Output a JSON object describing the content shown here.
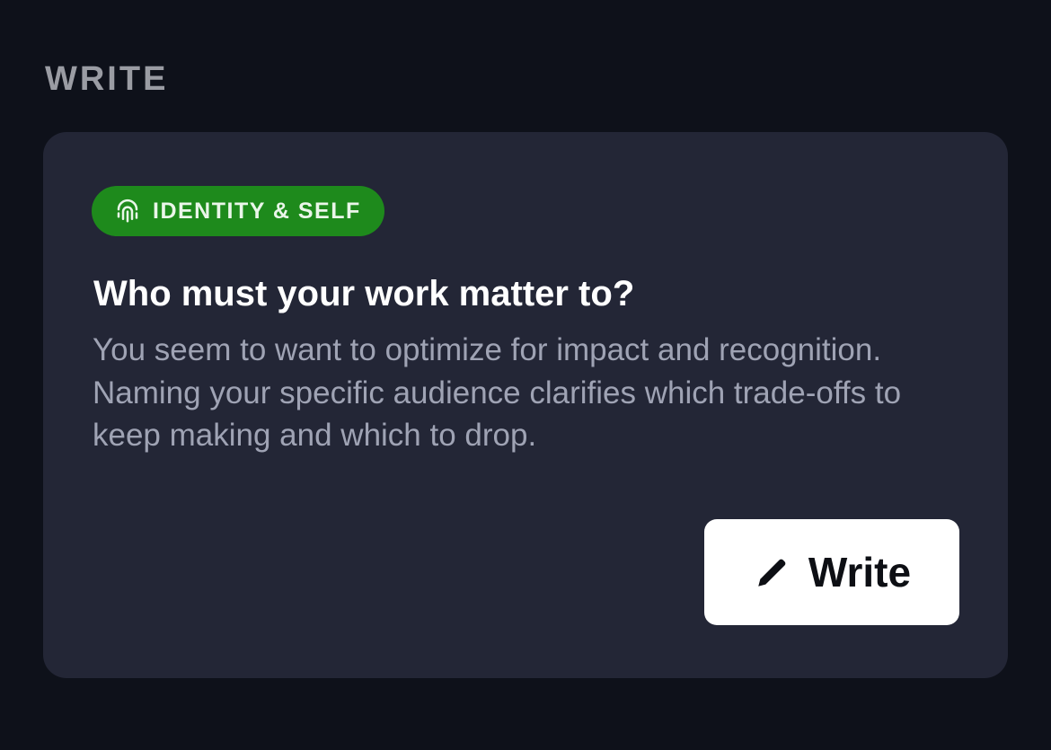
{
  "section": {
    "label": "WRITE"
  },
  "card": {
    "badge": {
      "icon": "fingerprint-icon",
      "label": "IDENTITY & SELF",
      "color": "#1e8a1c"
    },
    "title": "Who must your work matter to?",
    "body": "You seem to want to optimize for impact and recognition. Naming your specific audience clarifies which trade-offs to keep making and which to drop.",
    "action": {
      "icon": "pencil-icon",
      "label": "Write"
    }
  },
  "colors": {
    "background": "#0e111a",
    "card": "#232636",
    "accent": "#1e8a1c",
    "button": "#ffffff"
  }
}
